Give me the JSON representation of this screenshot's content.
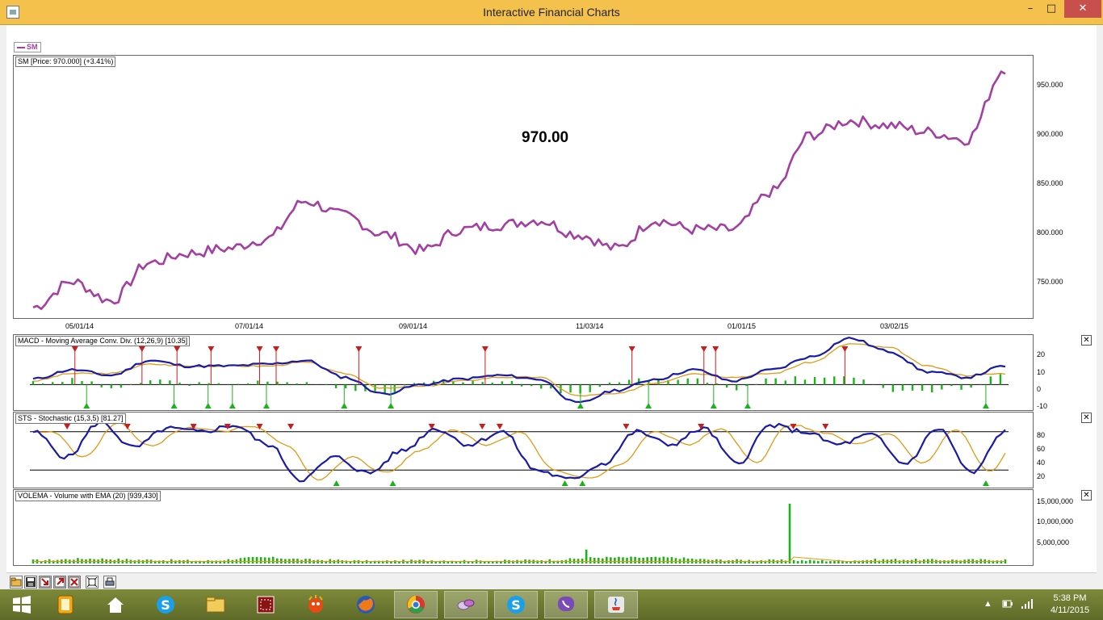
{
  "window": {
    "title": "Interactive Financial Charts",
    "minimize": "–",
    "maximize": "□",
    "close": "✕"
  },
  "legend": {
    "symbol": "SM",
    "color": "#a33ea3"
  },
  "price_panel": {
    "label": "SM [Price: 970.000] (+3.41%)",
    "big_price": "970.00",
    "y_ticks": [
      "950.000",
      "900.000",
      "850.000",
      "800.000",
      "750.000"
    ],
    "x_ticks": [
      "05/01/14",
      "07/01/14",
      "09/01/14",
      "11/03/14",
      "01/01/15",
      "03/02/15"
    ]
  },
  "macd_panel": {
    "label": "MACD - Moving Average Conv. Div. (12,26,9) [10.35]",
    "y_ticks": [
      "20",
      "10",
      "0",
      "-10"
    ],
    "close": "✕"
  },
  "sts_panel": {
    "label": "STS - Stochastic (15,3,5) [81.27]",
    "y_ticks": [
      "80",
      "60",
      "40",
      "20"
    ],
    "close": "✕"
  },
  "vol_panel": {
    "label": "VOLEMA - Volume with EMA (20) [939,430]",
    "y_ticks": [
      "15,000,000",
      "10,000,000",
      "5,000,000"
    ],
    "close": "✕"
  },
  "toolbar": [
    "open-icon",
    "save-icon",
    "import-icon",
    "export-icon",
    "zoom-icon",
    "fit-icon",
    "print-icon"
  ],
  "taskbar": {
    "apps": [
      "start-icon",
      "notes-icon",
      "home-icon",
      "skype-icon",
      "file-explorer-icon",
      "game-icon",
      "puppet-icon",
      "firefox-icon",
      "chrome-icon",
      "pills-icon",
      "skype-icon-2",
      "viber-icon",
      "java-icon"
    ],
    "clock_time": "5:38 PM",
    "clock_date": "4/11/2015"
  },
  "colors": {
    "price_line": "#a33ea3",
    "macd_line": "#1a1aa8",
    "signal_line": "#e09a14",
    "histogram": "#1bb31b",
    "buy_marker": "#1bb31b",
    "sell_marker": "#d01a1a"
  },
  "chart_data": [
    {
      "type": "line",
      "title": "SM [Price: 970.000] (+3.41%)",
      "x": [
        "04/01/14",
        "04/15/14",
        "05/01/14",
        "05/15/14",
        "06/01/14",
        "06/15/14",
        "07/01/14",
        "07/15/14",
        "08/01/14",
        "08/15/14",
        "09/01/14",
        "09/15/14",
        "10/01/14",
        "10/15/14",
        "11/03/14",
        "11/17/14",
        "12/01/14",
        "12/15/14",
        "01/01/15",
        "01/15/15",
        "02/01/15",
        "02/15/15",
        "03/02/15",
        "03/16/15",
        "04/01/15",
        "04/10/15"
      ],
      "series": [
        {
          "name": "SM",
          "values": [
            718,
            745,
            725,
            765,
            775,
            780,
            790,
            830,
            815,
            795,
            778,
            800,
            805,
            810,
            795,
            780,
            810,
            800,
            800,
            840,
            900,
            915,
            910,
            903,
            895,
            970
          ]
        }
      ],
      "ylim": [
        710,
        980
      ],
      "y_ticks": [
        950,
        900,
        850,
        800,
        750
      ]
    },
    {
      "type": "line",
      "title": "MACD - Moving Average Conv. Div. (12,26,9) [10.35]",
      "ylim": [
        -12,
        25
      ],
      "y_ticks": [
        20,
        10,
        0,
        -10
      ],
      "series": [
        {
          "name": "MACD",
          "values": [
            3,
            8,
            5,
            13,
            10,
            10,
            11,
            13,
            4,
            -5,
            0,
            3,
            5,
            3,
            -10,
            -3,
            3,
            8,
            2,
            8,
            15,
            25,
            18,
            7,
            4,
            10
          ]
        },
        {
          "name": "Signal",
          "values": [
            2,
            6,
            6,
            11,
            10,
            10,
            10,
            12,
            6,
            -2,
            -1,
            2,
            4,
            4,
            -6,
            -5,
            1,
            6,
            4,
            6,
            12,
            22,
            20,
            10,
            5,
            6
          ]
        }
      ]
    },
    {
      "type": "line",
      "title": "STS - Stochastic (15,3,5) [81.27]",
      "ylim": [
        0,
        100
      ],
      "y_ticks": [
        80,
        60,
        40,
        20
      ],
      "series": [
        {
          "name": "STS",
          "values": [
            80,
            40,
            95,
            55,
            85,
            80,
            90,
            60,
            5,
            40,
            15,
            50,
            85,
            60,
            80,
            20,
            5,
            30,
            80,
            60,
            85,
            30,
            90,
            80,
            60,
            75,
            30,
            85,
            15,
            81
          ]
        }
      ]
    },
    {
      "type": "bar",
      "title": "VOLEMA - Volume with EMA (20) [939,430]",
      "ylim": [
        0,
        16000000
      ],
      "y_ticks": [
        15000000,
        10000000,
        5000000
      ],
      "series": [
        {
          "name": "Volume",
          "values": [
            800000,
            1200000,
            900000,
            700000,
            3500000,
            900000,
            600000,
            800000,
            700000,
            900000,
            15000000,
            1500000,
            900000,
            800000,
            700000,
            1000000,
            900000,
            939430
          ]
        }
      ]
    }
  ]
}
